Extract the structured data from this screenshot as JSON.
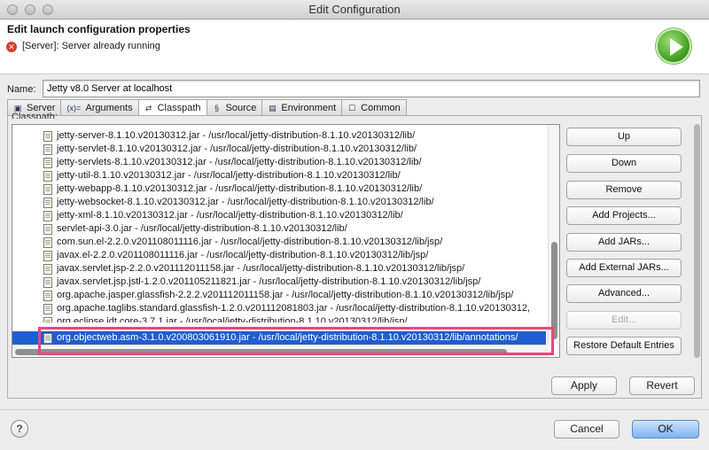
{
  "window": {
    "title": "Edit Configuration"
  },
  "header": {
    "title": "Edit launch configuration properties",
    "message": "[Server]: Server already running",
    "error_icon_glyph": "✕"
  },
  "name": {
    "label": "Name:",
    "value": "Jetty v8.0 Server at localhost"
  },
  "tabs": [
    {
      "label": "Server",
      "icon": "server-icon",
      "glyph": "▣"
    },
    {
      "label": "Arguments",
      "icon": "arguments-icon",
      "glyph": "(x)="
    },
    {
      "label": "Classpath",
      "icon": "classpath-icon",
      "glyph": "⇄"
    },
    {
      "label": "Source",
      "icon": "source-icon",
      "glyph": "§"
    },
    {
      "label": "Environment",
      "icon": "environment-icon",
      "glyph": "▤"
    },
    {
      "label": "Common",
      "icon": "common-icon",
      "glyph": "☐"
    }
  ],
  "classpath": {
    "section_label": "Classpath:",
    "entries": [
      "jetty-server-8.1.10.v20130312.jar - /usr/local/jetty-distribution-8.1.10.v20130312/lib/",
      "jetty-servlet-8.1.10.v20130312.jar - /usr/local/jetty-distribution-8.1.10.v20130312/lib/",
      "jetty-servlets-8.1.10.v20130312.jar - /usr/local/jetty-distribution-8.1.10.v20130312/lib/",
      "jetty-util-8.1.10.v20130312.jar - /usr/local/jetty-distribution-8.1.10.v20130312/lib/",
      "jetty-webapp-8.1.10.v20130312.jar - /usr/local/jetty-distribution-8.1.10.v20130312/lib/",
      "jetty-websocket-8.1.10.v20130312.jar - /usr/local/jetty-distribution-8.1.10.v20130312/lib/",
      "jetty-xml-8.1.10.v20130312.jar - /usr/local/jetty-distribution-8.1.10.v20130312/lib/",
      "servlet-api-3.0.jar - /usr/local/jetty-distribution-8.1.10.v20130312/lib/",
      "com.sun.el-2.2.0.v201108011116.jar - /usr/local/jetty-distribution-8.1.10.v20130312/lib/jsp/",
      "javax.el-2.2.0.v201108011116.jar - /usr/local/jetty-distribution-8.1.10.v20130312/lib/jsp/",
      "javax.servlet.jsp-2.2.0.v201112011158.jar - /usr/local/jetty-distribution-8.1.10.v20130312/lib/jsp/",
      "javax.servlet.jsp.jstl-1.2.0.v201105211821.jar - /usr/local/jetty-distribution-8.1.10.v20130312/lib/jsp/",
      "org.apache.jasper.glassfish-2.2.2.v201112011158.jar - /usr/local/jetty-distribution-8.1.10.v20130312/lib/jsp/",
      "org.apache.taglibs.standard.glassfish-1.2.0.v201112081803.jar - /usr/local/jetty-distribution-8.1.10.v20130312,",
      "org.eclipse.jdt.core-3.7.1.jar - /usr/local/jetty-distribution-8.1.10.v20130312/lib/jsp/",
      "org.objectweb.asm-3.1.0.v200803061910.jar - /usr/local/jetty-distribution-8.1.10.v20130312/lib/annotations/"
    ]
  },
  "side_buttons": {
    "up": "Up",
    "down": "Down",
    "remove": "Remove",
    "add_projects": "Add Projects...",
    "add_jars": "Add JARs...",
    "add_external_jars": "Add External JARs...",
    "advanced": "Advanced...",
    "edit": "Edit...",
    "restore": "Restore Default Entries"
  },
  "footer": {
    "apply": "Apply",
    "revert": "Revert",
    "cancel": "Cancel",
    "ok": "OK",
    "help_glyph": "?"
  }
}
